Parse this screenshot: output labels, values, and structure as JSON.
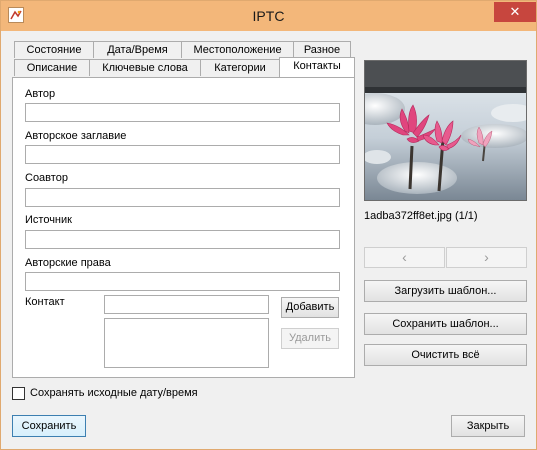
{
  "window": {
    "title": "IPTC",
    "close_glyph": "✕",
    "icon": "app-icon"
  },
  "tabs_row1": [
    {
      "label": "Состояние",
      "active": false
    },
    {
      "label": "Дата/Время",
      "active": false
    },
    {
      "label": "Местоположение",
      "active": false
    },
    {
      "label": "Разное",
      "active": false
    }
  ],
  "tabs_row2": [
    {
      "label": "Описание",
      "active": false
    },
    {
      "label": "Ключевые слова",
      "active": false
    },
    {
      "label": "Категории",
      "active": false
    },
    {
      "label": "Контакты",
      "active": true
    }
  ],
  "form": {
    "author_label": "Автор",
    "author_value": "",
    "author_title_label": "Авторское заглавие",
    "author_title_value": "",
    "coauthor_label": "Соавтор",
    "coauthor_value": "",
    "source_label": "Источник",
    "source_value": "",
    "copyright_label": "Авторские права",
    "copyright_value": "",
    "contact_label": "Контакт",
    "contact_value": "",
    "add_label": "Добавить",
    "remove_label": "Удалить"
  },
  "image": {
    "filename": "1adba372ff8et.jpg (1/1)"
  },
  "nav": {
    "prev_glyph": "‹",
    "next_glyph": "›"
  },
  "side_buttons": {
    "load_template": "Загрузить шаблон...",
    "save_template": "Сохранить шаблон...",
    "clear_all": "Очистить всё"
  },
  "keep_date": {
    "label": "Сохранять исходные дату/время",
    "checked": false
  },
  "footer": {
    "save_label": "Сохранить",
    "close_label": "Закрыть"
  },
  "colors": {
    "titlebar": "#f3b77a",
    "close": "#c7463e",
    "lotus": "#e0457e"
  }
}
